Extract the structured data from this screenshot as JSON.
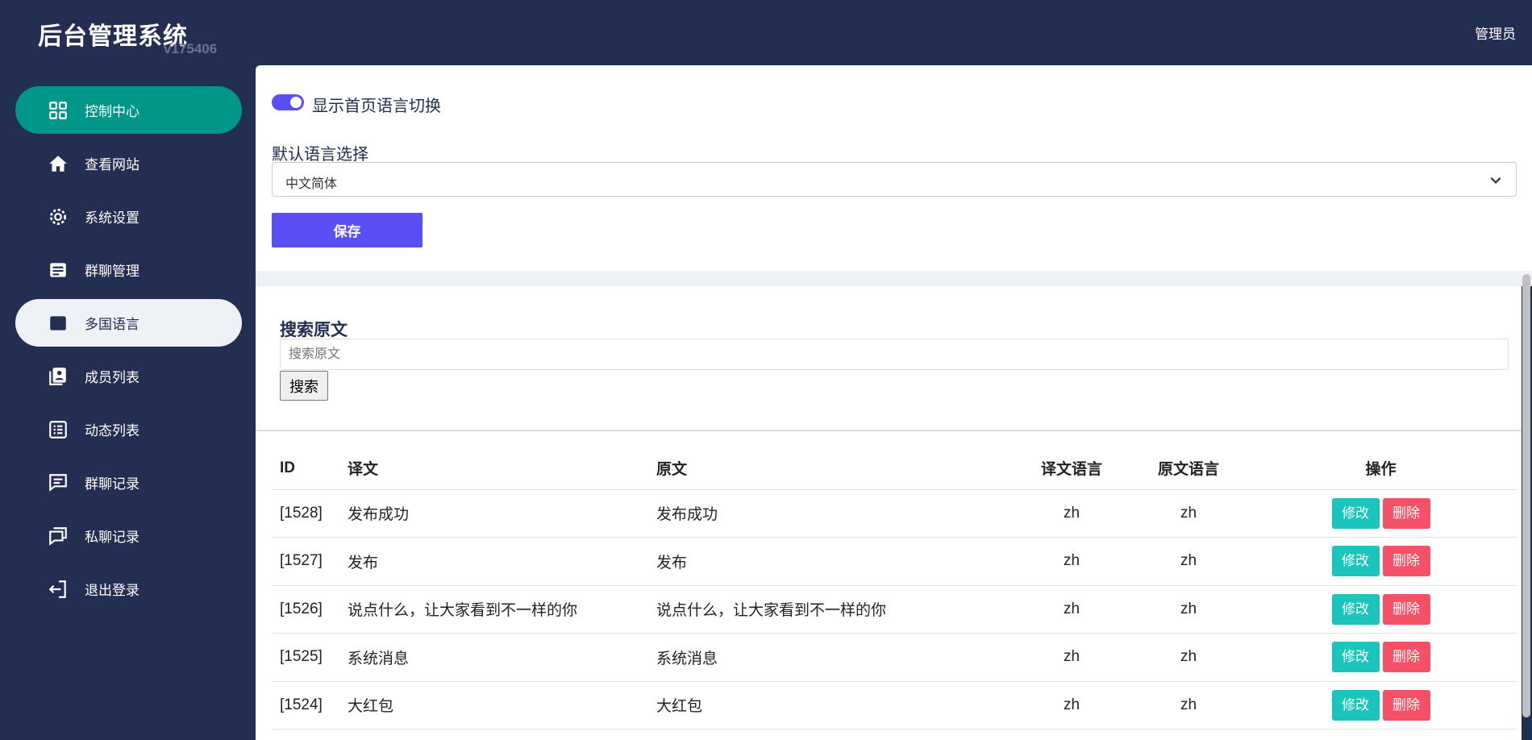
{
  "app": {
    "title": "后台管理系统",
    "version": "v175406",
    "user": "管理员"
  },
  "sidebar": {
    "items": [
      {
        "label": "控制中心",
        "icon": "grid-icon"
      },
      {
        "label": "查看网站",
        "icon": "home-icon"
      },
      {
        "label": "系统设置",
        "icon": "gear-icon"
      },
      {
        "label": "群聊管理",
        "icon": "document-icon"
      },
      {
        "label": "多国语言",
        "icon": "document-icon"
      },
      {
        "label": "成员列表",
        "icon": "contacts-icon"
      },
      {
        "label": "动态列表",
        "icon": "list-icon"
      },
      {
        "label": "群聊记录",
        "icon": "chat-icon"
      },
      {
        "label": "私聊记录",
        "icon": "chats-icon"
      },
      {
        "label": "退出登录",
        "icon": "logout-icon"
      }
    ]
  },
  "settings": {
    "toggle_label": "显示首页语言切换",
    "toggle_on": true,
    "select_label": "默认语言选择",
    "select_value": "中文简体",
    "save": "保存"
  },
  "search": {
    "heading": "搜索原文",
    "placeholder": "搜索原文",
    "button": "搜索"
  },
  "table": {
    "headers": [
      "ID",
      "译文",
      "原文",
      "译文语言",
      "原文语言",
      "操作"
    ],
    "edit": "修改",
    "delete": "删除",
    "rows": [
      {
        "id": "[1528]",
        "translation": "发布成功",
        "original": "发布成功",
        "tlang": "zh",
        "olang": "zh"
      },
      {
        "id": "[1527]",
        "translation": "发布",
        "original": "发布",
        "tlang": "zh",
        "olang": "zh"
      },
      {
        "id": "[1526]",
        "translation": "说点什么，让大家看到不一样的你",
        "original": "说点什么，让大家看到不一样的你",
        "tlang": "zh",
        "olang": "zh"
      },
      {
        "id": "[1525]",
        "translation": "系统消息",
        "original": "系统消息",
        "tlang": "zh",
        "olang": "zh"
      },
      {
        "id": "[1524]",
        "translation": "大红包",
        "original": "大红包",
        "tlang": "zh",
        "olang": "zh"
      }
    ]
  }
}
